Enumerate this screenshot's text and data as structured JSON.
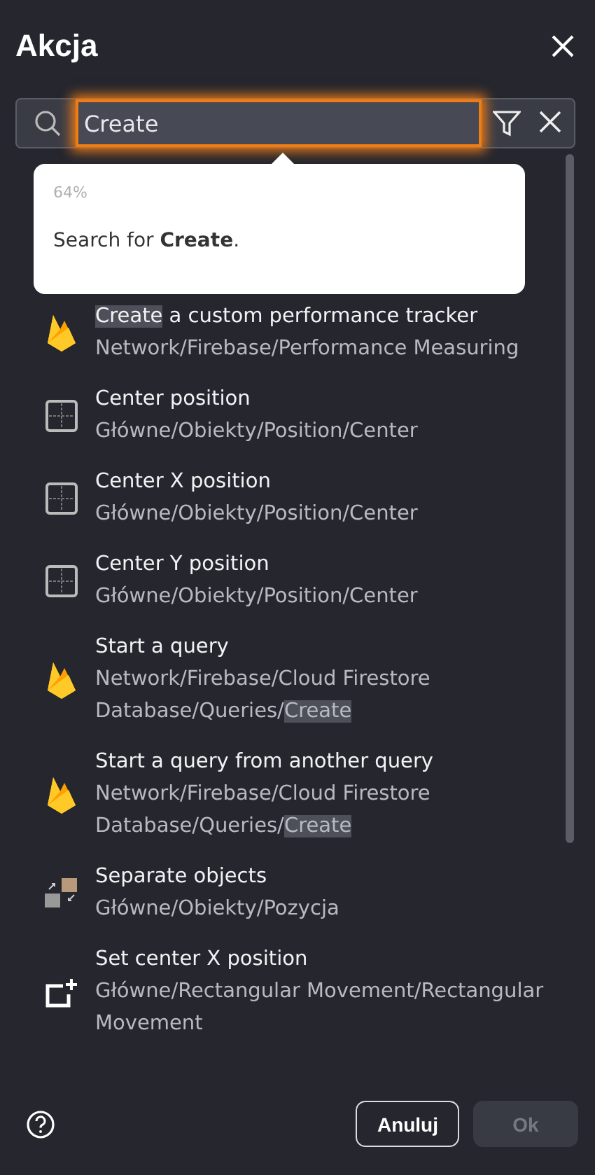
{
  "dialog": {
    "title": "Akcja"
  },
  "search": {
    "value": "Create",
    "focused": true
  },
  "tooltip": {
    "percent": "64%",
    "message": "Search for **Create**."
  },
  "results": [
    {
      "kind": "firebase",
      "title": [
        {
          "text": "Create",
          "highlighted": true
        },
        {
          "text": " a custom performance tracker",
          "highlighted": false
        }
      ],
      "path": [
        {
          "text": "Network/Firebase/Performance Measuring",
          "highlighted": false
        }
      ]
    },
    {
      "kind": "grid",
      "title": [
        {
          "text": "Center position",
          "highlighted": false
        }
      ],
      "path": [
        {
          "text": "Główne/Obiekty/Position/Center",
          "highlighted": false
        }
      ]
    },
    {
      "kind": "grid",
      "title": [
        {
          "text": "Center X position",
          "highlighted": false
        }
      ],
      "path": [
        {
          "text": "Główne/Obiekty/Position/Center",
          "highlighted": false
        }
      ]
    },
    {
      "kind": "grid",
      "title": [
        {
          "text": "Center Y position",
          "highlighted": false
        }
      ],
      "path": [
        {
          "text": "Główne/Obiekty/Position/Center",
          "highlighted": false
        }
      ]
    },
    {
      "kind": "firebase",
      "title": [
        {
          "text": "Start a query",
          "highlighted": false
        }
      ],
      "path": [
        {
          "text": "Network/Firebase/Cloud Firestore Database/Queries/",
          "highlighted": false
        },
        {
          "text": "Create",
          "highlighted": true
        }
      ]
    },
    {
      "kind": "firebase",
      "title": [
        {
          "text": "Start a query from another query",
          "highlighted": false
        }
      ],
      "path": [
        {
          "text": "Network/Firebase/Cloud Firestore Database/Queries/",
          "highlighted": false
        },
        {
          "text": "Create",
          "highlighted": true
        }
      ]
    },
    {
      "kind": "separate",
      "title": [
        {
          "text": "Separate objects",
          "highlighted": false
        }
      ],
      "path": [
        {
          "text": "Główne/Obiekty/Pozycja",
          "highlighted": false
        }
      ]
    },
    {
      "kind": "center-add",
      "title": [
        {
          "text": "Set center X position",
          "highlighted": false
        }
      ],
      "path": [
        {
          "text": "Główne/Rectangular Movement/Rectangular Movement",
          "highlighted": false
        }
      ]
    }
  ],
  "buttons": [
    {
      "label": "Anuluj",
      "disabled": false
    },
    {
      "label": "Ok",
      "disabled": true
    }
  ]
}
